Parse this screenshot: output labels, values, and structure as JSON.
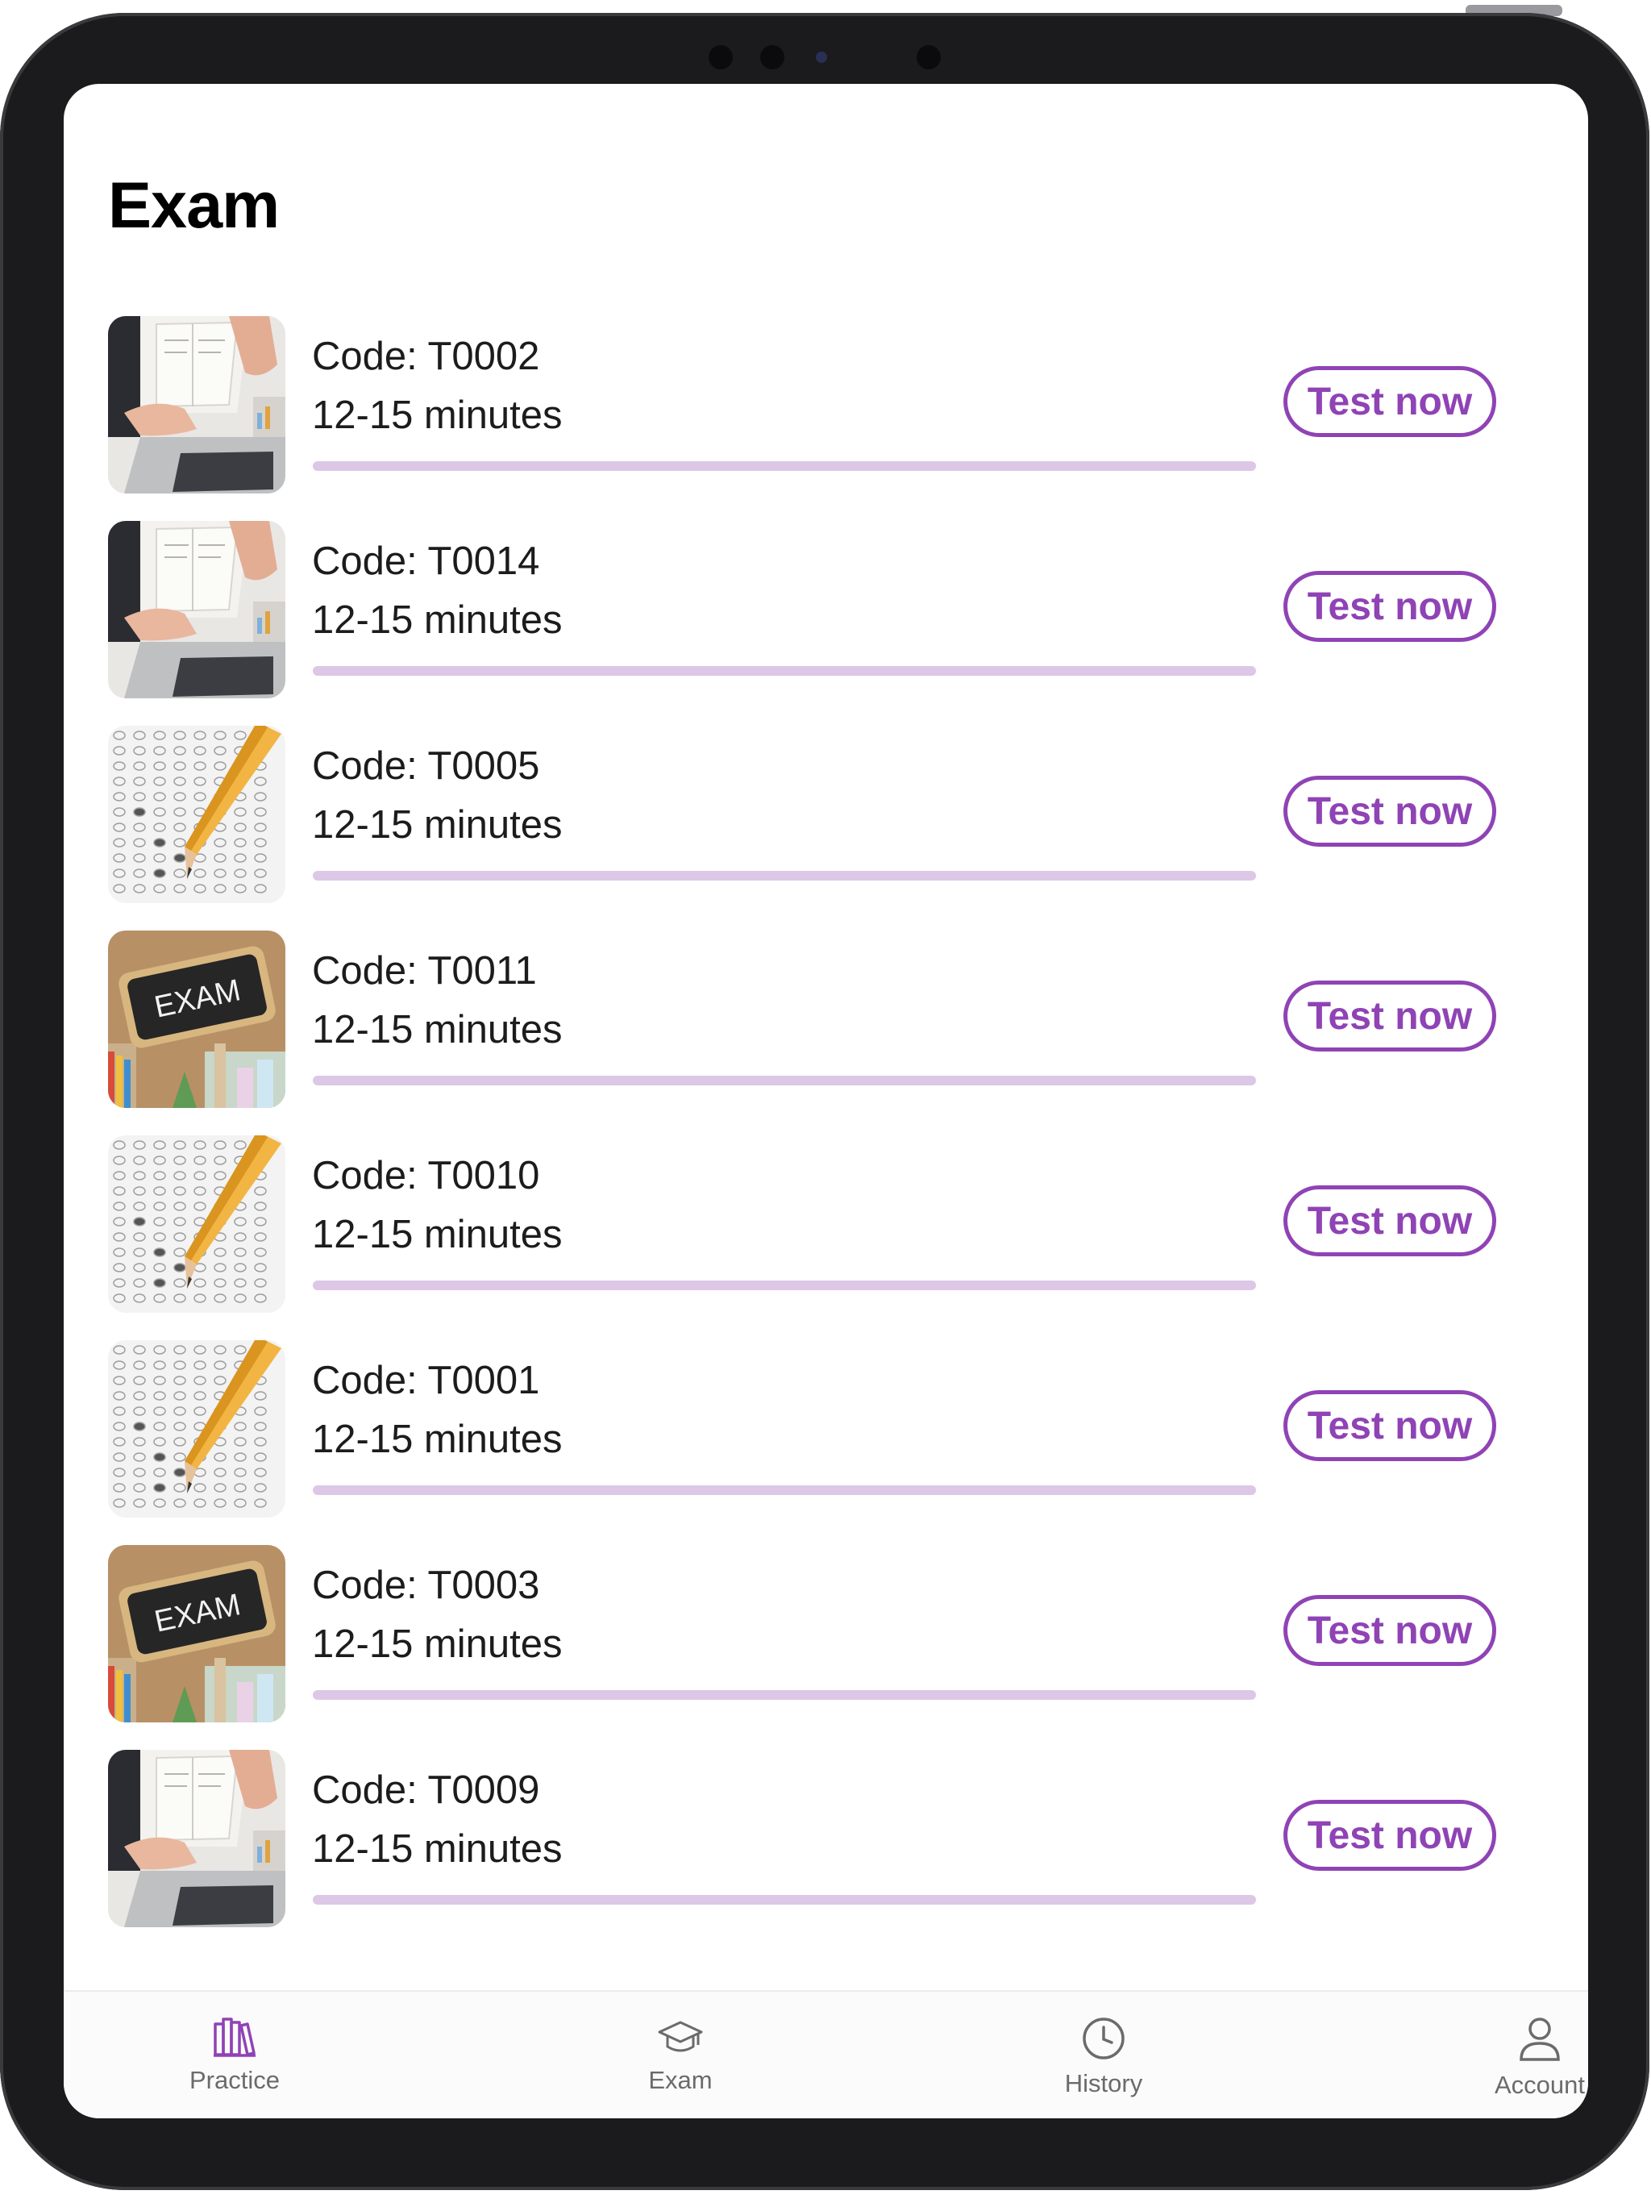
{
  "header": {
    "title": "Exam"
  },
  "exams": [
    {
      "code": "Code: T0002",
      "duration": "12-15 minutes",
      "progress": 0,
      "button": "Test now",
      "image": "laptop-notebook-photo"
    },
    {
      "code": "Code: T0014",
      "duration": "12-15 minutes",
      "progress": 0,
      "button": "Test now",
      "image": "laptop-notebook-photo"
    },
    {
      "code": "Code: T0005",
      "duration": "12-15 minutes",
      "progress": 0,
      "button": "Test now",
      "image": "pencil-answer-sheet-photo"
    },
    {
      "code": "Code: T0011",
      "duration": "12-15 minutes",
      "progress": 0,
      "button": "Test now",
      "image": "exam-chalkboard-sign-photo"
    },
    {
      "code": "Code: T0010",
      "duration": "12-15 minutes",
      "progress": 0,
      "button": "Test now",
      "image": "pencil-answer-sheet-photo"
    },
    {
      "code": "Code: T0001",
      "duration": "12-15 minutes",
      "progress": 0,
      "button": "Test now",
      "image": "pencil-answer-sheet-photo"
    },
    {
      "code": "Code: T0003",
      "duration": "12-15 minutes",
      "progress": 0,
      "button": "Test now",
      "image": "exam-chalkboard-sign-photo"
    },
    {
      "code": "Code: T0009",
      "duration": "12-15 minutes",
      "progress": 0,
      "button": "Test now",
      "image": "laptop-notebook-photo"
    }
  ],
  "sign_text": "EXAM",
  "tabbar": {
    "tabs": [
      {
        "label": "Practice",
        "icon": "books-icon",
        "active": true
      },
      {
        "label": "Exam",
        "icon": "graduation-cap-icon",
        "active": false
      },
      {
        "label": "History",
        "icon": "clock-icon",
        "active": false
      },
      {
        "label": "Account",
        "icon": "person-icon",
        "active": false
      }
    ]
  },
  "colors": {
    "accent": "#8f43b5",
    "progress_track": "#dcc7e6",
    "text": "#1c1c1c"
  }
}
